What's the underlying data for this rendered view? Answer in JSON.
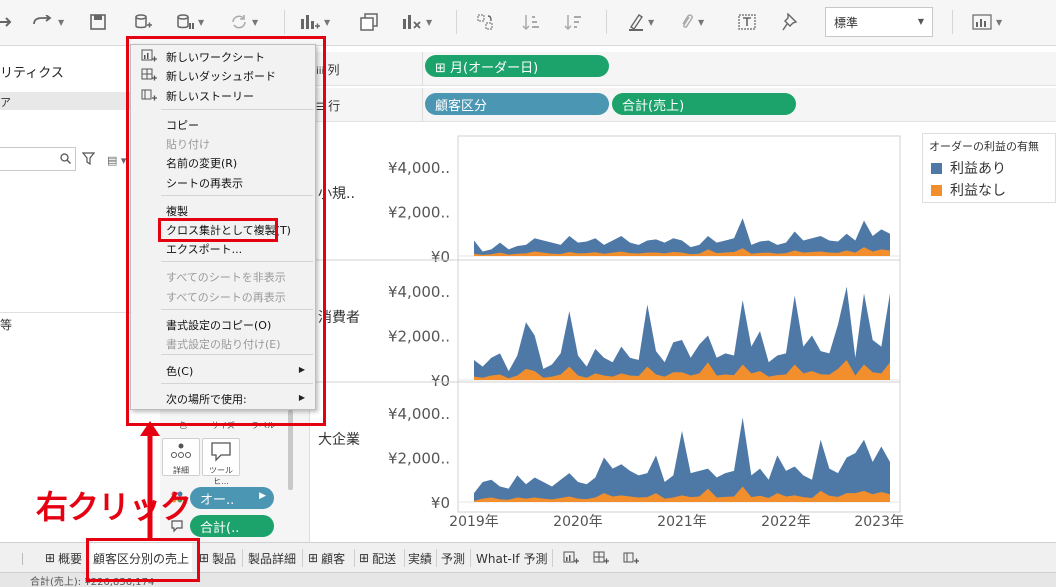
{
  "toolbar": {
    "style_select": "標準"
  },
  "left_pane": {
    "analytics_fragment": "リティクス",
    "area_fragment": "ア",
    "lower_fragment": "等"
  },
  "shelves": {
    "columns_label": "列",
    "rows_label": "行",
    "columns_pills": [
      {
        "label": "⊞ 月(オーダー日)"
      }
    ],
    "rows_pills": [
      {
        "label": "顧客区分"
      },
      {
        "label": "合計(売上)"
      }
    ]
  },
  "marks": {
    "detail_label": "詳細",
    "tooltip_label": "ツールヒ...",
    "partial_labels": [
      "色",
      "サイズ",
      "ラベル"
    ],
    "pills": [
      {
        "label": "オー..",
        "icon": "color-dots-icon"
      },
      {
        "label": "合計(..",
        "icon": "tooltip-icon"
      }
    ]
  },
  "context_menu": {
    "items": [
      {
        "label": "新しいワークシート",
        "icon": "new-worksheet-icon",
        "enabled": true
      },
      {
        "label": "新しいダッシュボード",
        "icon": "new-dashboard-icon",
        "enabled": true
      },
      {
        "label": "新しいストーリー",
        "icon": "new-story-icon",
        "enabled": true
      },
      {
        "label": "コピー",
        "enabled": true
      },
      {
        "label": "貼り付け",
        "enabled": false
      },
      {
        "label": "名前の変更(R)",
        "enabled": true
      },
      {
        "label": "シートの再表示",
        "enabled": true
      },
      {
        "label": "複製",
        "enabled": true
      },
      {
        "label": "クロス集計として複製(T)",
        "enabled": true
      },
      {
        "label": "エクスポート...",
        "enabled": true
      },
      {
        "label": "すべてのシートを非表示",
        "enabled": false
      },
      {
        "label": "すべてのシートの再表示",
        "enabled": false
      },
      {
        "label": "書式設定のコピー(O)",
        "enabled": true
      },
      {
        "label": "書式設定の貼り付け(E)",
        "enabled": false
      },
      {
        "label": "色(C)",
        "enabled": true,
        "submenu": true
      },
      {
        "label": "次の場所で使用:",
        "enabled": true,
        "submenu": true
      }
    ]
  },
  "annotation": {
    "text": "右クリック",
    "color": "#e50012"
  },
  "legend": {
    "title": "オーダーの利益の有無",
    "items": [
      {
        "label": "利益あり",
        "color": "#4e79a7"
      },
      {
        "label": "利益なし",
        "color": "#f28e2b"
      }
    ]
  },
  "chart_data": {
    "type": "area",
    "stacked": true,
    "panes": [
      "小規..",
      "消費者",
      "大企業"
    ],
    "y_ticks": [
      "¥4,000..",
      "¥2,000..",
      "¥0"
    ],
    "y_tick_values": [
      4000,
      2000,
      0
    ],
    "x_ticks": [
      "2019年",
      "2020年",
      "2021年",
      "2022年",
      "2023年"
    ],
    "x_tick_positions": [
      0,
      12,
      24,
      36,
      48
    ],
    "ylim": [
      0,
      4500
    ],
    "series": [
      {
        "name": "利益あり",
        "color": "#4e79a7",
        "values": [
          [
            700,
            200,
            300,
            600,
            300,
            450,
            500,
            800,
            700,
            600,
            500,
            900,
            600,
            650,
            800,
            500,
            700,
            900,
            600,
            500,
            700,
            750,
            600,
            800,
            700,
            400,
            500,
            900,
            600,
            700,
            800,
            1700,
            500,
            650,
            700,
            500,
            600,
            1100,
            700,
            800,
            900,
            700,
            650,
            1000,
            700,
            1600,
            900,
            1200,
            1000
          ],
          [
            900,
            600,
            1000,
            1200,
            400,
            1100,
            2600,
            2000,
            500,
            700,
            1200,
            3100,
            1100,
            600,
            1400,
            1000,
            800,
            1500,
            1000,
            900,
            3400,
            1300,
            800,
            1700,
            1800,
            1000,
            1600,
            2000,
            1000,
            1200,
            1100,
            3600,
            1500,
            2200,
            800,
            1100,
            1200,
            3800,
            1500,
            2000,
            1300,
            1200,
            2500,
            4200,
            1000,
            3900,
            1800,
            1500,
            3900
          ],
          [
            400,
            900,
            1000,
            700,
            600,
            1200,
            800,
            1100,
            900,
            700,
            1000,
            1300,
            900,
            800,
            1100,
            2000,
            1500,
            1700,
            1400,
            1200,
            1300,
            2100,
            900,
            1200,
            3200,
            1300,
            1400,
            1500,
            1100,
            1300,
            1400,
            3800,
            1200,
            1500,
            1000,
            2100,
            1400,
            1600,
            1200,
            1000,
            2800,
            1500,
            1300,
            2000,
            2200,
            2800,
            1800,
            2500,
            1800
          ]
        ]
      },
      {
        "name": "利益なし",
        "color": "#f28e2b",
        "values": [
          [
            100,
            50,
            80,
            150,
            60,
            100,
            120,
            200,
            150,
            100,
            90,
            180,
            120,
            130,
            170,
            100,
            150,
            200,
            130,
            110,
            150,
            160,
            120,
            180,
            150,
            80,
            100,
            300,
            130,
            160,
            180,
            350,
            100,
            140,
            150,
            100,
            130,
            250,
            150,
            180,
            200,
            150,
            140,
            250,
            150,
            400,
            200,
            300,
            250
          ],
          [
            150,
            100,
            200,
            250,
            80,
            200,
            500,
            400,
            100,
            150,
            250,
            600,
            200,
            100,
            300,
            200,
            150,
            300,
            200,
            180,
            600,
            250,
            150,
            350,
            350,
            200,
            300,
            800,
            200,
            250,
            220,
            700,
            300,
            400,
            150,
            220,
            250,
            700,
            300,
            400,
            260,
            240,
            500,
            900,
            200,
            700,
            350,
            300,
            800
          ],
          [
            50,
            150,
            200,
            120,
            100,
            200,
            150,
            200,
            150,
            120,
            180,
            250,
            150,
            130,
            200,
            400,
            250,
            300,
            250,
            200,
            220,
            400,
            150,
            200,
            300,
            220,
            250,
            600,
            200,
            230,
            250,
            700,
            220,
            280,
            180,
            400,
            250,
            300,
            220,
            180,
            500,
            280,
            230,
            400,
            400,
            500,
            350,
            450,
            350
          ]
        ]
      }
    ]
  },
  "sheet_tabs": [
    {
      "label": "概要",
      "grid": true,
      "active": false
    },
    {
      "label": "顧客区分別の売上",
      "grid": false,
      "active": true
    },
    {
      "label": "製品",
      "grid": true,
      "active": false
    },
    {
      "label": "製品詳細",
      "grid": false,
      "active": false
    },
    {
      "label": "顧客",
      "grid": true,
      "active": false
    },
    {
      "label": "配送",
      "grid": true,
      "active": false
    },
    {
      "label": "実績",
      "grid": false,
      "active": false
    },
    {
      "label": "予測",
      "grid": false,
      "active": false
    },
    {
      "label": "What-If 予測",
      "grid": false,
      "active": false
    }
  ],
  "status_bar": {
    "text": "合計(売上): ¥226,856,174"
  }
}
